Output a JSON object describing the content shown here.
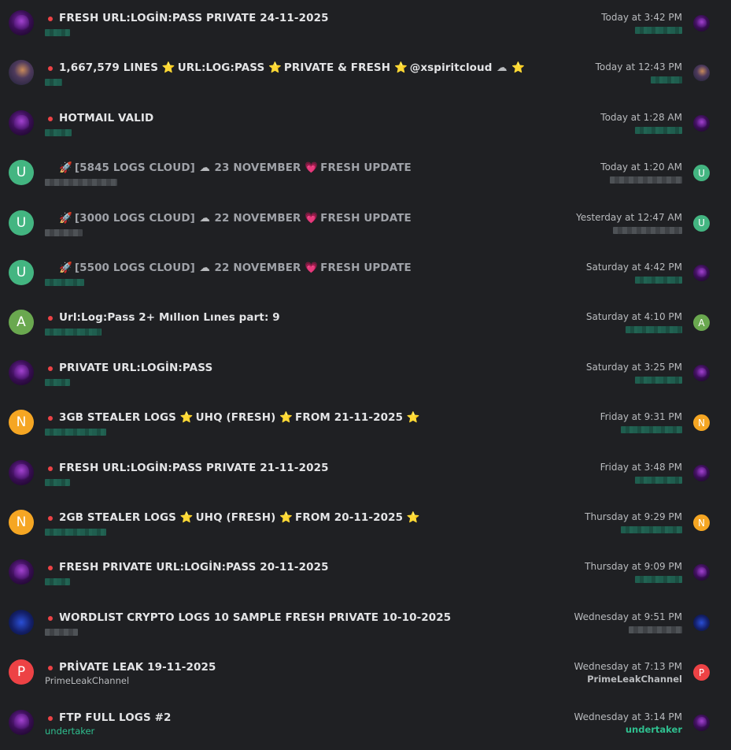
{
  "rows": [
    {
      "title": "FRESH URL:LOGİN:PASS PRIVATE 24-11-2025",
      "time": "Today at 3:42 PM",
      "avatar": "purple",
      "avatar_letter": "",
      "small_avatar": "purple",
      "small_letter": ""
    },
    {
      "title_parts": [
        "1,667,579 LINES",
        "URL:LOG:PASS",
        "PRIVATE & FRESH",
        "@xspiritcloud"
      ],
      "time": "Today at 12:43 PM",
      "avatar": "warrior",
      "small_avatar": "warrior"
    },
    {
      "title": "HOTMAIL VALID",
      "time": "Today at 1:28 AM",
      "avatar": "purple",
      "small_avatar": "purple"
    },
    {
      "title_parts": [
        "[5845 LOGS CLOUD]",
        "23 NOVEMBER",
        "FRESH UPDATE"
      ],
      "time": "Today at 1:20 AM",
      "avatar": "green",
      "avatar_letter": "U",
      "small_avatar": "green",
      "small_letter": "U"
    },
    {
      "title_parts": [
        "[3000 LOGS CLOUD]",
        "22 NOVEMBER",
        "FRESH UPDATE"
      ],
      "time": "Yesterday at 12:47 AM",
      "avatar": "green",
      "avatar_letter": "U",
      "small_avatar": "green",
      "small_letter": "U"
    },
    {
      "title_parts": [
        "[5500 LOGS CLOUD]",
        "22 NOVEMBER",
        "FRESH UPDATE"
      ],
      "time": "Saturday at 4:42 PM",
      "avatar": "green",
      "avatar_letter": "U",
      "small_avatar": "purple"
    },
    {
      "title": "Url:Log:Pass 2+ Mıllıon Lınes part: 9",
      "time": "Saturday at 4:10 PM",
      "avatar": "olive",
      "avatar_letter": "A",
      "small_avatar": "olive",
      "small_letter": "A"
    },
    {
      "title": "PRIVATE URL:LOGİN:PASS",
      "time": "Saturday at 3:25 PM",
      "avatar": "purple",
      "small_avatar": "purple"
    },
    {
      "title_parts": [
        "3GB STEALER LOGS",
        "UHQ (FRESH)",
        "FROM 21-11-2025"
      ],
      "time": "Friday at 9:31 PM",
      "avatar": "orange",
      "avatar_letter": "N",
      "small_avatar": "orange",
      "small_letter": "N"
    },
    {
      "title": "FRESH URL:LOGİN:PASS PRIVATE 21-11-2025",
      "time": "Friday at 3:48 PM",
      "avatar": "purple",
      "small_avatar": "purple"
    },
    {
      "title_parts": [
        "2GB STEALER LOGS",
        "UHQ (FRESH)",
        "FROM 20-11-2025"
      ],
      "time": "Thursday at 9:29 PM",
      "avatar": "orange",
      "avatar_letter": "N",
      "small_avatar": "orange",
      "small_letter": "N"
    },
    {
      "title": "FRESH PRIVATE URL:LOGİN:PASS 20-11-2025",
      "time": "Thursday at 9:09 PM",
      "avatar": "purple",
      "small_avatar": "purple"
    },
    {
      "title": "WORDLIST CRYPTO LOGS 10 SAMPLE FRESH PRIVATE 10-10-2025",
      "time": "Wednesday at 9:51 PM",
      "avatar": "eagle",
      "small_avatar": "eagle"
    },
    {
      "title": "PRİVATE LEAK 19-11-2025",
      "time": "Wednesday at 7:13 PM",
      "avatar": "red",
      "avatar_letter": "P",
      "small_avatar": "red",
      "small_letter": "P",
      "author": "PrimeLeakChannel",
      "last_poster": "PrimeLeakChannel"
    },
    {
      "title": "FTP FULL LOGS #2",
      "time": "Wednesday at 3:14 PM",
      "avatar": "purple",
      "small_avatar": "purple",
      "author": "undertaker",
      "last_poster": "undertaker"
    }
  ],
  "emoji": {
    "star": "⭐",
    "cloud": "☁",
    "heart": "💗",
    "rocket": "🚀"
  }
}
